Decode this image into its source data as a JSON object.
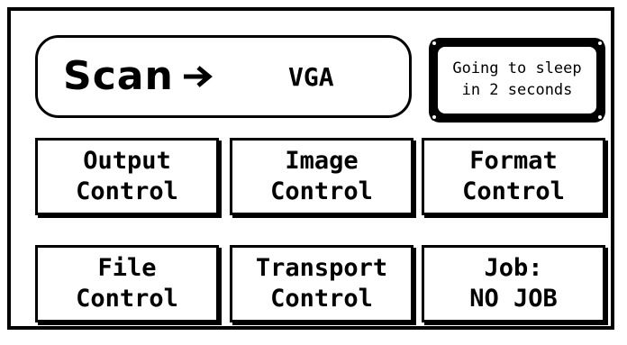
{
  "scan": {
    "label": "Scan",
    "arrow_icon": "right-arrow-icon",
    "target": "VGA"
  },
  "status": {
    "line1": "Going to sleep",
    "line2": "in 2 seconds"
  },
  "buttons": [
    {
      "line1": "Output",
      "line2": "Control"
    },
    {
      "line1": "Image",
      "line2": "Control"
    },
    {
      "line1": "Format",
      "line2": "Control"
    },
    {
      "line1": "File",
      "line2": "Control"
    },
    {
      "line1": "Transport",
      "line2": "Control"
    },
    {
      "line1": "Job:",
      "line2": "NO JOB"
    }
  ]
}
